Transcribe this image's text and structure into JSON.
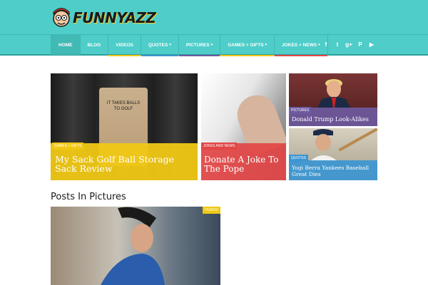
{
  "brand": {
    "logo_text": "FUNNYAZZ"
  },
  "colors": {
    "header": "#4ecdc9",
    "games": "#f0c814",
    "jokes": "#e24646",
    "pictures": "#6e5aa0",
    "quotes": "#3c96d2"
  },
  "nav": {
    "items": [
      {
        "label": "HOME",
        "active": true,
        "underline": ""
      },
      {
        "label": "BLOG",
        "active": false,
        "underline": ""
      },
      {
        "label": "VIDEOS",
        "active": false,
        "underline": "#f0c814"
      },
      {
        "label": "QUOTES",
        "active": false,
        "underline": "#3c96d2"
      },
      {
        "label": "PICTURES",
        "active": false,
        "underline": "#6e5aa0"
      },
      {
        "label": "GAMES + GIFTS",
        "active": false,
        "underline": "#f0c814"
      },
      {
        "label": "JOKES + NEWS",
        "active": false,
        "underline": "#e24646"
      }
    ],
    "social": [
      "facebook-icon",
      "twitter-icon",
      "google-plus-icon",
      "pinterest-icon",
      "youtube-icon"
    ]
  },
  "featured": [
    {
      "category": "GAMES + GIFTS",
      "title": "My Sack Golf Ball Storage Sack Review",
      "image_text": "IT TAKES BALLS TO GOLF"
    },
    {
      "category": "JOKES AND NEWS",
      "title": "Donate A Joke To The Pope"
    },
    {
      "category": "PICTURES",
      "title": "Donald Trump Look-Alikes"
    },
    {
      "category": "QUOTES",
      "title": "Yogi Berra Yankees Baseball Great Dies"
    }
  ],
  "posts_section": {
    "title": "Posts In Pictures",
    "badge": "Humor"
  }
}
